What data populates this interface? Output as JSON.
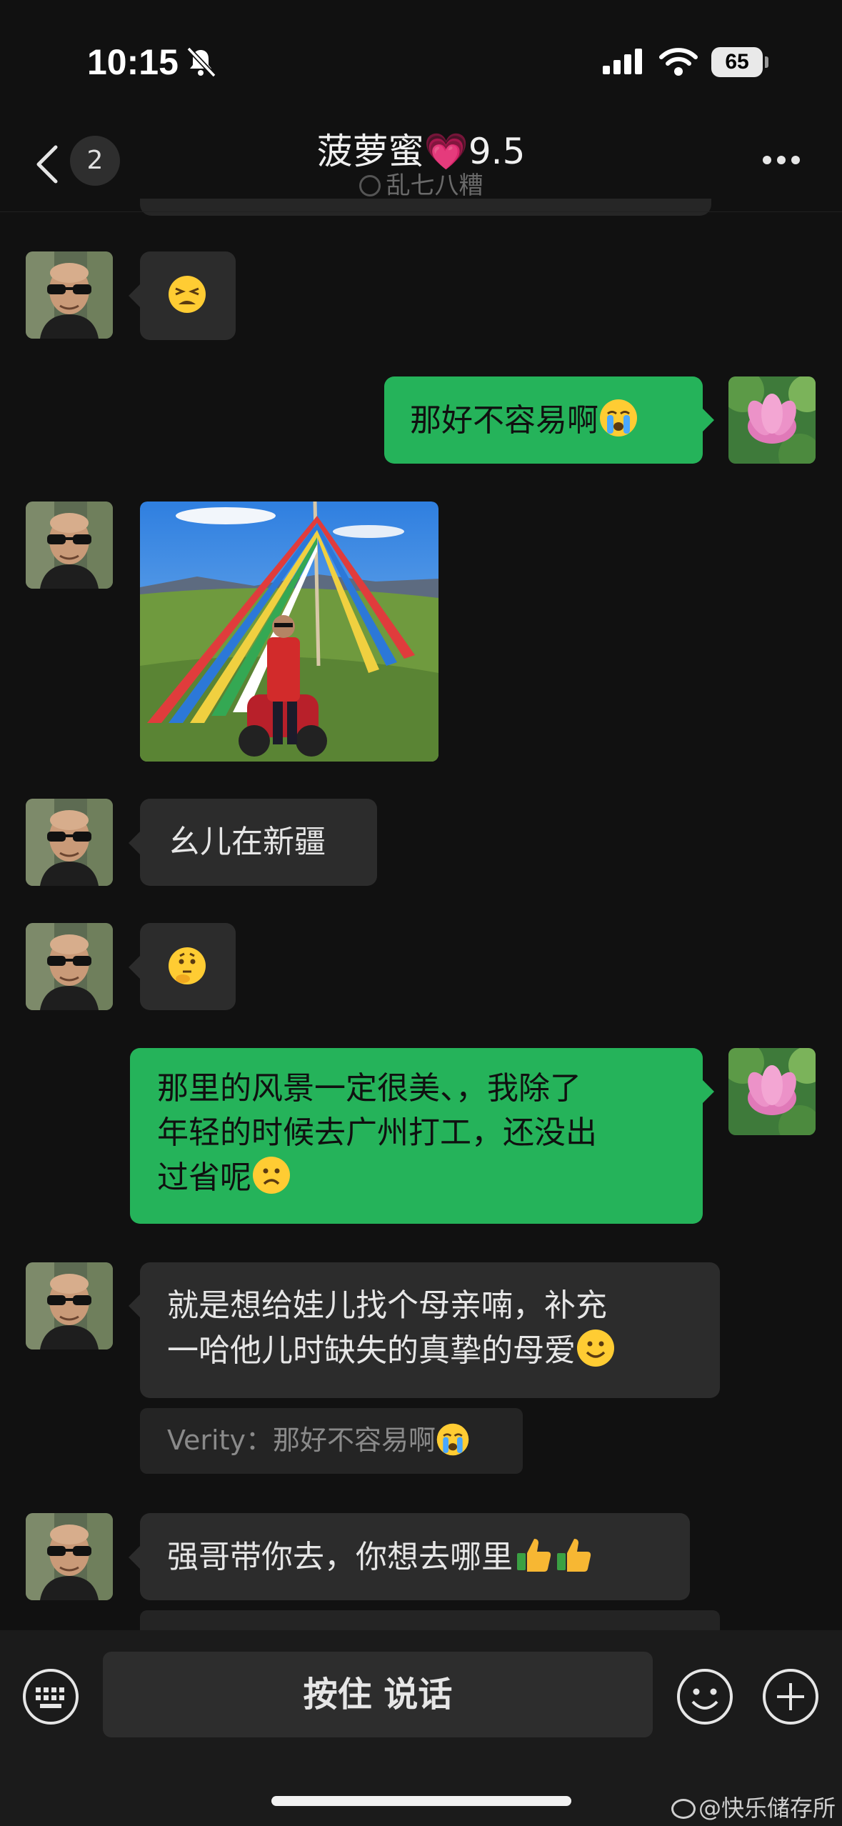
{
  "status_bar": {
    "time": "10:15",
    "battery": "65"
  },
  "header": {
    "back_badge": "2",
    "title": "菠萝蜜💗9.5",
    "subtitle": "乱七八糟"
  },
  "messages": [
    {
      "side": "in",
      "type": "emoji",
      "emoji": "tired-face-icon"
    },
    {
      "side": "out",
      "type": "text",
      "text": "那好不容易啊",
      "emoji": "crying-face-icon"
    },
    {
      "side": "in",
      "type": "image",
      "image": "photo-prayer-flags-motorcycle"
    },
    {
      "side": "in",
      "type": "text",
      "text": "幺儿在新疆"
    },
    {
      "side": "in",
      "type": "emoji",
      "emoji": "thinking-face-icon"
    },
    {
      "side": "out",
      "type": "text",
      "lines": [
        "那里的风景一定很美、，我除了",
        "年轻的时候去广州打工，还没出",
        "过省呢"
      ],
      "emoji": "frowning-face-icon"
    },
    {
      "side": "in",
      "type": "text",
      "lines": [
        "就是想给娃儿找个母亲喃，补充",
        "一哈他儿时缺失的真挚的母爱"
      ],
      "emoji": "smiling-face-icon",
      "quote": {
        "name": "Verity：",
        "text": "那好不容易啊"
      }
    },
    {
      "side": "in",
      "type": "text",
      "text": "强哥带你去，你想去哪里",
      "emoji": "thumbs-up-icon"
    }
  ],
  "composer": {
    "hold_to_talk": "按住 说话"
  },
  "watermark": "@快乐储存所",
  "colors": {
    "background": "#111111",
    "bubble_in": "#2c2c2c",
    "bubble_out": "#25b35a"
  }
}
